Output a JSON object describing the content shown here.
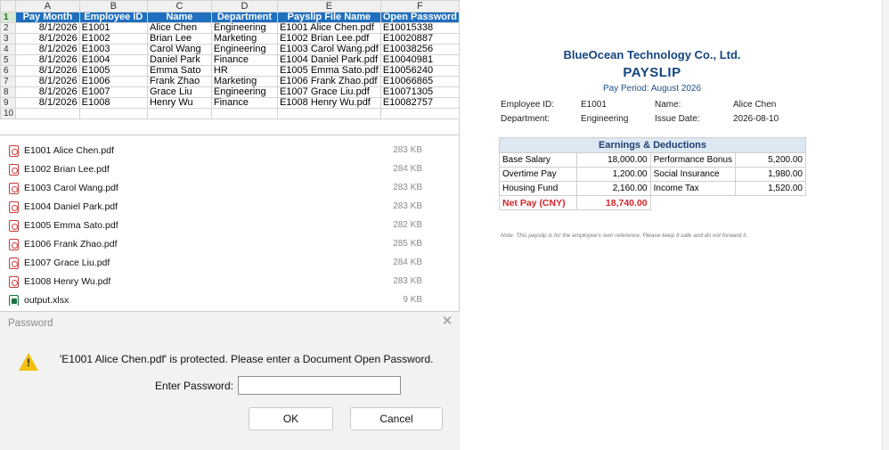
{
  "spreadsheet": {
    "columns": [
      "A",
      "B",
      "C",
      "D",
      "E",
      "F"
    ],
    "row_numbers": [
      "1",
      "2",
      "3",
      "4",
      "5",
      "6",
      "7",
      "8",
      "9",
      "10"
    ],
    "headers": [
      "Pay Month",
      "Employee ID",
      "Name",
      "Department",
      "Payslip File Name",
      "Open Password"
    ],
    "rows": [
      [
        "8/1/2026",
        "E1001",
        "Alice Chen",
        "Engineering",
        "E1001 Alice Chen.pdf",
        "E10015338"
      ],
      [
        "8/1/2026",
        "E1002",
        "Brian Lee",
        "Marketing",
        "E1002 Brian Lee.pdf",
        "E10020887"
      ],
      [
        "8/1/2026",
        "E1003",
        "Carol Wang",
        "Engineering",
        "E1003 Carol Wang.pdf",
        "E10038256"
      ],
      [
        "8/1/2026",
        "E1004",
        "Daniel Park",
        "Finance",
        "E1004 Daniel Park.pdf",
        "E10040981"
      ],
      [
        "8/1/2026",
        "E1005",
        "Emma Sato",
        "HR",
        "E1005 Emma Sato.pdf",
        "E10056240"
      ],
      [
        "8/1/2026",
        "E1006",
        "Frank Zhao",
        "Marketing",
        "E1006 Frank Zhao.pdf",
        "E10066865"
      ],
      [
        "8/1/2026",
        "E1007",
        "Grace Liu",
        "Engineering",
        "E1007 Grace Liu.pdf",
        "E10071305"
      ],
      [
        "8/1/2026",
        "E1008",
        "Henry Wu",
        "Finance",
        "E1008 Henry Wu.pdf",
        "E10082757"
      ]
    ]
  },
  "files": [
    {
      "name": "E1001 Alice Chen.pdf",
      "size": "283 KB",
      "icon": "pdf-file-icon"
    },
    {
      "name": "E1002 Brian Lee.pdf",
      "size": "284 KB",
      "icon": "pdf-file-icon"
    },
    {
      "name": "E1003 Carol Wang.pdf",
      "size": "283 KB",
      "icon": "pdf-file-icon"
    },
    {
      "name": "E1004 Daniel Park.pdf",
      "size": "283 KB",
      "icon": "pdf-file-icon"
    },
    {
      "name": "E1005 Emma Sato.pdf",
      "size": "282 KB",
      "icon": "pdf-file-icon"
    },
    {
      "name": "E1006 Frank Zhao.pdf",
      "size": "285 KB",
      "icon": "pdf-file-icon"
    },
    {
      "name": "E1007 Grace Liu.pdf",
      "size": "284 KB",
      "icon": "pdf-file-icon"
    },
    {
      "name": "E1008 Henry Wu.pdf",
      "size": "283 KB",
      "icon": "pdf-file-icon"
    },
    {
      "name": "output.xlsx",
      "size": "9 KB",
      "icon": "excel-file-icon"
    }
  ],
  "dialog": {
    "title": "Password",
    "close": "✕",
    "message": "'E1001 Alice Chen.pdf' is protected. Please enter a Document Open Password.",
    "password_label": "Enter Password:",
    "password_value": "",
    "ok_label": "OK",
    "cancel_label": "Cancel",
    "warning_mark": "!"
  },
  "payslip": {
    "company": "BlueOcean Technology Co., Ltd.",
    "title": "PAYSLIP",
    "period": "Pay Period: August 2026",
    "employee_id_label": "Employee ID:",
    "employee_id": "E1001",
    "name_label": "Name:",
    "name": "Alice Chen",
    "department_label": "Department:",
    "department": "Engineering",
    "issue_date_label": "Issue Date:",
    "issue_date": "2026-08-10",
    "table_title": "Earnings & Deductions",
    "rows": [
      [
        "Base Salary",
        "18,000.00",
        "Performance Bonus",
        "5,200.00"
      ],
      [
        "Overtime Pay",
        "1,200.00",
        "Social Insurance",
        "1,980.00"
      ],
      [
        "Housing Fund",
        "2,160.00",
        "Income Tax",
        "1,520.00"
      ]
    ],
    "net_label": "Net Pay (CNY)",
    "net_value": "18,740.00",
    "note": "Note: This payslip is for the employee's own reference. Please keep it safe and do not forward it."
  },
  "colors": {
    "header_blue": "#1f6fbf",
    "payslip_blue": "#14457f",
    "net_red": "#d6232a",
    "warning_yellow": "#f2c10f"
  }
}
